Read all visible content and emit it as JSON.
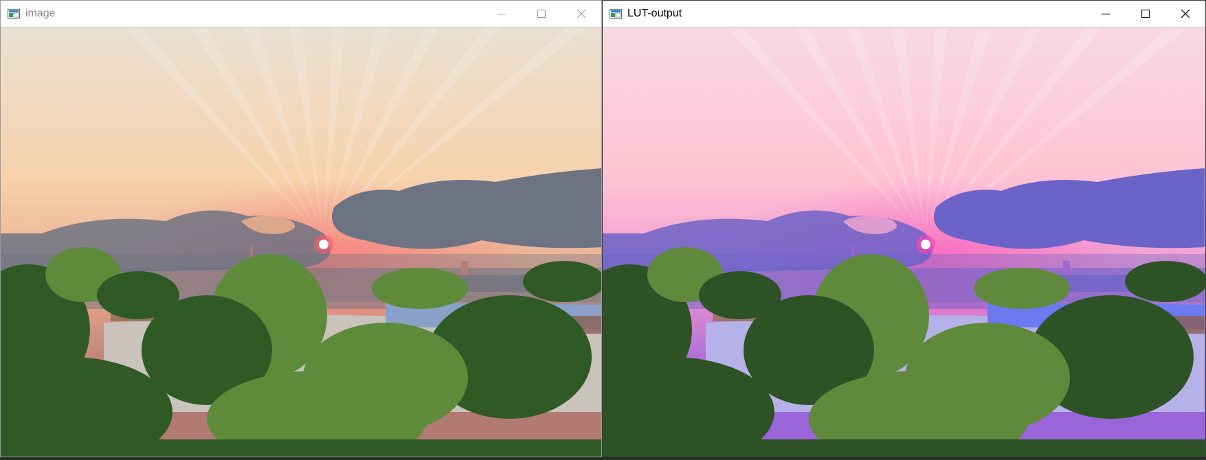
{
  "windows": [
    {
      "title": "image",
      "variant": "original",
      "controls": [
        "minimize-icon",
        "maximize-icon",
        "close-icon"
      ]
    },
    {
      "title": "LUT-output",
      "variant": "lut",
      "controls": [
        "minimize-icon",
        "maximize-icon",
        "close-icon"
      ]
    }
  ],
  "palette": {
    "original": {
      "sky_top": "#e9e0d2",
      "sky_mid": "#f7d2ac",
      "sky_low": "#e6a58b",
      "horizon": "#b37a74",
      "cloud": "#6d7383",
      "cloud_glow": "#f2b48f",
      "sun": "#ffffff",
      "sun_glow": "#ff5a6c",
      "trees": "#2f5a26",
      "trees_light": "#5d8b3a",
      "roof": "#c9c2bd",
      "roof_blue": "#8aa0c8"
    },
    "lut": {
      "sky_top": "#f7d9e2",
      "sky_mid": "#ffc3d3",
      "sky_low": "#e990d0",
      "horizon": "#9a65d8",
      "cloud": "#6b63c8",
      "cloud_glow": "#f5a9d0",
      "sun": "#ffffff",
      "sun_glow": "#ff3fb2",
      "trees": "#2c5225",
      "trees_light": "#5f8a3b",
      "roof": "#b6b1e8",
      "roof_blue": "#6d79f0"
    }
  }
}
